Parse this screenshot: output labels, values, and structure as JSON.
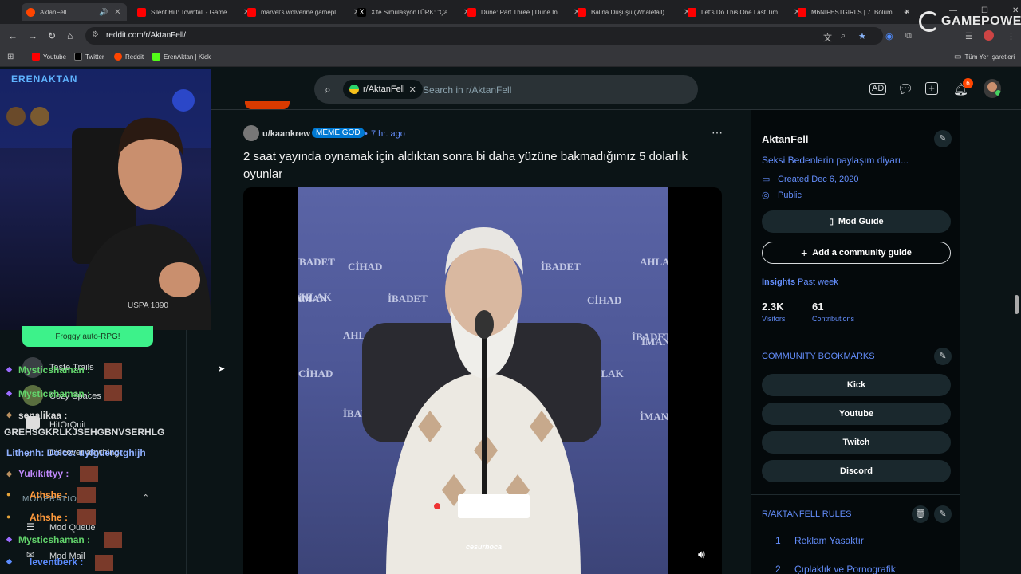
{
  "browser": {
    "tabs": [
      {
        "title": "AktanFell",
        "color": "#ff4500",
        "active": true
      },
      {
        "title": "Silent Hill: Townfall - Game",
        "color": "#ff0000"
      },
      {
        "title": "marvel's wolverine gamepl",
        "color": "#ff0000"
      },
      {
        "title": "X'te SimülasyonTÜRK: \"Ça",
        "color": "#e8eaed"
      },
      {
        "title": "Dune: Part Three | Dune In",
        "color": "#ff0000"
      },
      {
        "title": "Balina Düşüşü (Whalefall)",
        "color": "#ff0000"
      },
      {
        "title": "Let's Do This One Last Tim",
        "color": "#ff0000"
      },
      {
        "title": "M6NIFESTGIRLS | 7. Bölüm",
        "color": "#ff0000"
      }
    ],
    "url": "reddit.com/r/AktanFell/",
    "bookmarks": [
      "Youtube",
      "Twitter",
      "Reddit",
      "ErenAktan | Kick"
    ],
    "all_bookmarks": "Tüm Yer İşaretleri",
    "overlay_logo": "GAMEPOWER",
    "stream_logo": "ERENAKTAN"
  },
  "search": {
    "chip": "r/AktanFell",
    "placeholder": "Search in r/AktanFell"
  },
  "header": {
    "notification_count": "6"
  },
  "left": {
    "froggy": "Froggy auto-RPG!",
    "items": [
      "Taste Trails",
      "Cozy Spaces",
      "HitOrQuit",
      "Discover anything"
    ],
    "moderation": "MODERATION",
    "mod_items": [
      "Mod Queue",
      "Mod Mail"
    ],
    "chat": [
      {
        "user": "Mysticshaman :",
        "color": "#62d36b"
      },
      {
        "user": "Mysticshaman :",
        "color": "#62d36b"
      },
      {
        "user": "senalikaa :",
        "color": "#d9d9d9"
      },
      {
        "user": "GREHSGKRLKJSEHGBNVSERHLG",
        "color": "#d7dadc"
      },
      {
        "user": "Lithenh: Dolcs: uyfguerotghijh",
        "color": "#8fb0ff"
      },
      {
        "user": "Yukikittyy :",
        "color": "#c38aff"
      },
      {
        "user": "Athshe :",
        "color": "#ff9a3c"
      },
      {
        "user": "Athshe :",
        "color": "#ff9a3c"
      },
      {
        "user": "Mysticshaman :",
        "color": "#62d36b"
      },
      {
        "user": "leventberk :",
        "color": "#5c8cff"
      }
    ]
  },
  "post": {
    "author": "u/kaankrew",
    "flair": "MEME GOD",
    "time": "7 hr. ago",
    "title": "2 saat yayında oynamak için aldıktan sonra bi daha yüzüne bakmadığımız 5 dolarlık oyunlar",
    "backdrop_words": [
      "CİHAD",
      "İBADET",
      "AHLAK",
      "İMAN",
      "İBADET",
      "CİHAD",
      "AHLAK",
      "İBADET",
      "CİHAD",
      "AHLAK",
      "İMAN",
      "İBADET",
      "İMAN",
      "İBADET",
      "AHLAK"
    ],
    "watermark": "cesurhoca"
  },
  "sidebar": {
    "name": "AktanFell",
    "description": "Seksi Bedenlerin paylaşım diyarı...",
    "created": "Created Dec 6, 2020",
    "visibility": "Public",
    "mod_guide": "Mod Guide",
    "add_guide": "Add a community guide",
    "insights": "Insights",
    "past_week": "Past week",
    "visitors_value": "2.3K",
    "visitors_label": "Visitors",
    "contrib_value": "61",
    "contrib_label": "Contributions",
    "bookmarks_title": "COMMUNITY BOOKMARKS",
    "bookmarks": [
      "Kick",
      "Youtube",
      "Twitch",
      "Discord"
    ],
    "rules_title": "R/AKTANFELL RULES",
    "rules": [
      {
        "n": "1",
        "text": "Reklam Yasaktır"
      },
      {
        "n": "2",
        "text": "Çıplaklık ve Pornografik"
      }
    ]
  },
  "colors": {
    "accent": "#0079d3",
    "link": "#648efc",
    "bg": "#0b1416"
  }
}
